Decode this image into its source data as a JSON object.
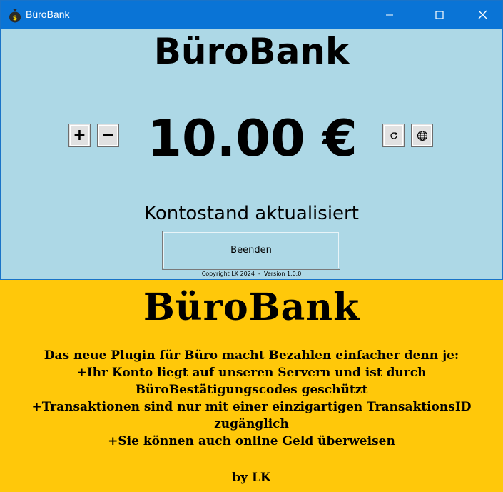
{
  "window": {
    "title": "BüroBank",
    "icon": "money-bag-icon",
    "controls": [
      "minimize-icon",
      "maximize-icon",
      "close-icon"
    ],
    "titlebar_color": "#0a74d6",
    "background_color": "#add8e6"
  },
  "main": {
    "app_title": "BüroBank",
    "plus_label": "+",
    "minus_label": "−",
    "balance": "10.00 €",
    "refresh_icon": "refresh-icon",
    "globe_icon": "globe-icon",
    "status": "Kontostand aktualisiert",
    "quit_label": "Beenden",
    "copyright": "Copyright LK 2024  -  Version 1.0.0"
  },
  "ad": {
    "background_color": "#ffc80a",
    "title": "BüroBank",
    "lines": [
      "Das neue Plugin für Büro macht Bezahlen einfacher denn je:",
      "+Ihr Konto liegt auf unseren Servern und ist durch BüroBestätigungscodes geschützt",
      "+Transaktionen sind nur mit einer einzigartigen TransaktionsID zugänglich",
      "+Sie können auch online Geld überweisen"
    ],
    "signature": "by LK"
  }
}
